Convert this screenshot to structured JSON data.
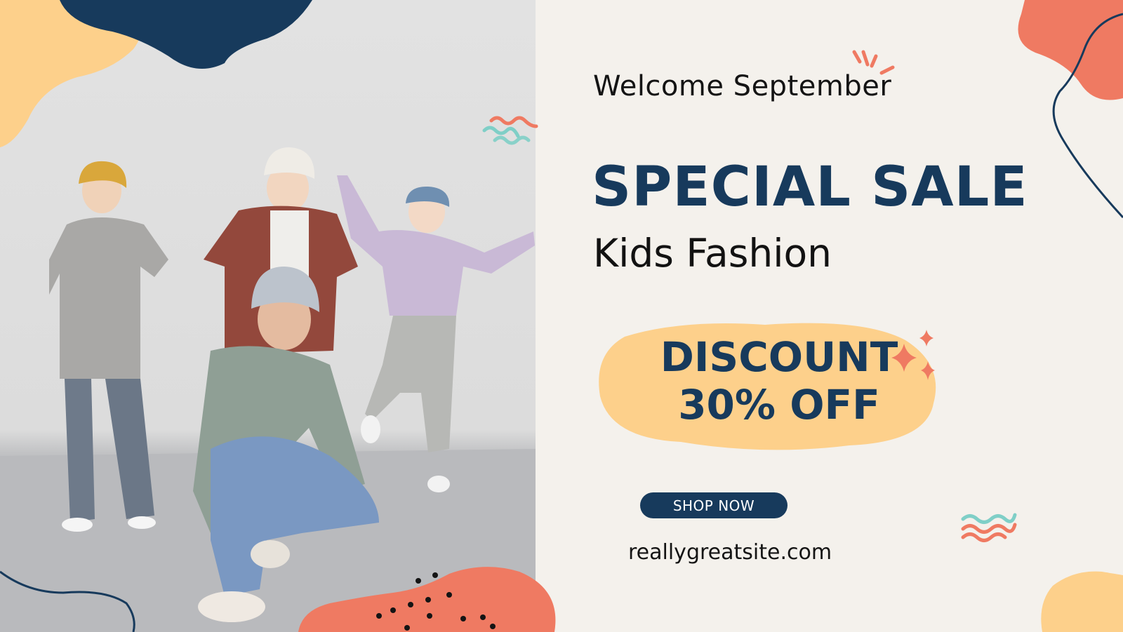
{
  "banner": {
    "welcome": "Welcome September",
    "title": "SPECIAL SALE",
    "subtitle": "Kids Fashion",
    "discount_line1": "DISCOUNT",
    "discount_line2": "30% OFF",
    "shop_button": "SHOP NOW",
    "website": "reallygreatsite.com"
  },
  "colors": {
    "navy": "#173a5c",
    "coral": "#ef7a62",
    "peach": "#fdd08b",
    "teal": "#7fcfc7",
    "background": "#f4f1ec"
  },
  "photo": {
    "description_icon": "kids-dancing-photo"
  }
}
